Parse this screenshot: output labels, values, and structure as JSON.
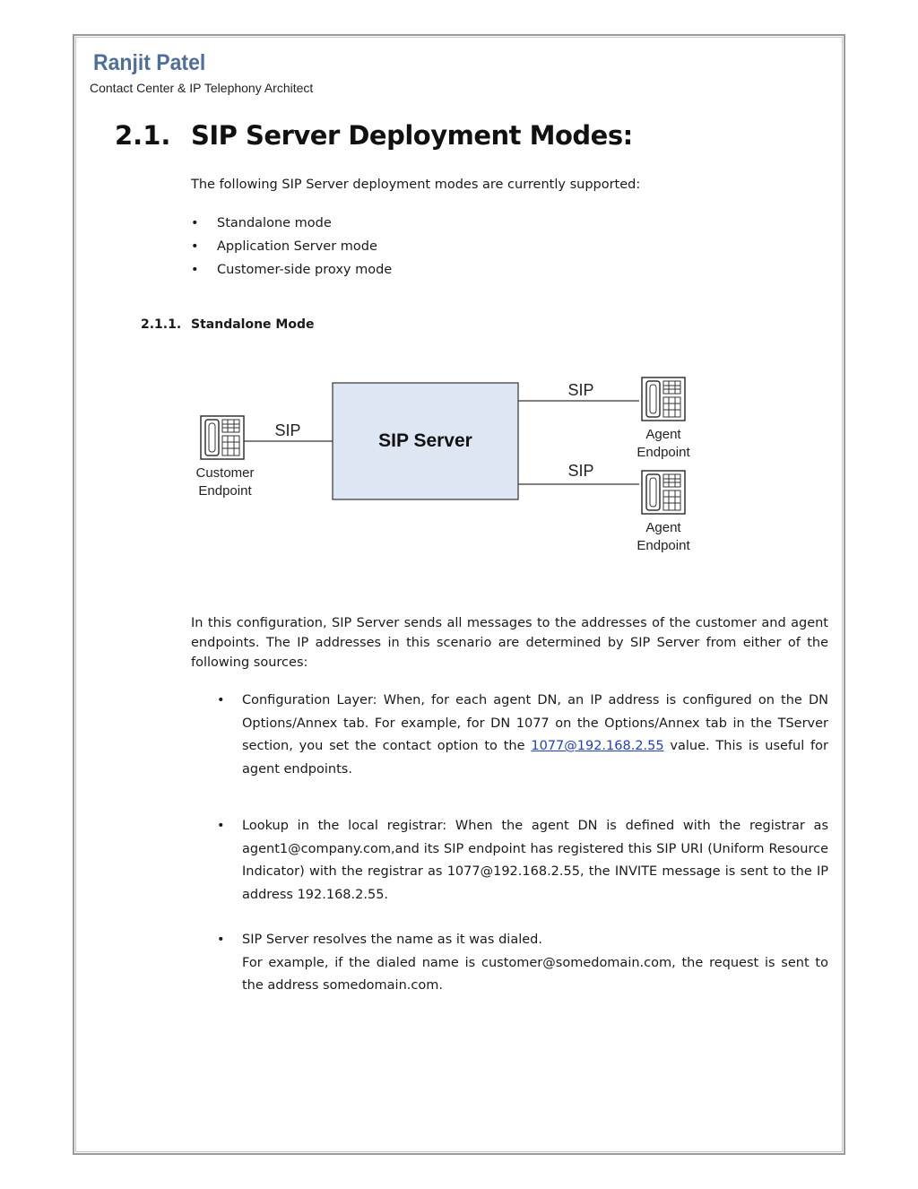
{
  "header": {
    "brand": "Ranjit Patel",
    "tagline": "Contact Center & IP Telephony Architect"
  },
  "section": {
    "number": "2.1.",
    "title": "SIP Server Deployment Modes:",
    "intro": "The following SIP Server deployment modes are currently supported:",
    "modes": [
      "Standalone mode",
      "Application Server mode",
      "Customer-side proxy mode"
    ],
    "bullet": "•"
  },
  "subsection": {
    "number": "2.1.1.",
    "title": "Standalone Mode"
  },
  "diagram": {
    "server_label": "SIP Server",
    "customer_link_label": "SIP",
    "agent_link_label_1": "SIP",
    "agent_link_label_2": "SIP",
    "customer_label_line1": "Customer",
    "customer_label_line2": "Endpoint",
    "agent1_label_line1": "Agent",
    "agent1_label_line2": "Endpoint",
    "agent2_label_line1": "Agent",
    "agent2_label_line2": "Endpoint",
    "server_fill": "#dde6f3"
  },
  "body": {
    "paragraph": "In this configuration, SIP Server sends all messages to the addresses of the customer and agent endpoints. The IP addresses in this scenario are determined by SIP Server from either of the following sources:",
    "sources": [
      {
        "text_before": "Configuration Layer: When, for each agent DN, an IP address is configured on the DN Options/Annex tab. For example, for DN 1077 on the Options/Annex tab in the TServer section, you set the contact option to the ",
        "link": "1077@192.168.2.55",
        "text_after": " value. This is useful for agent endpoints."
      },
      {
        "text": "Lookup in the local registrar: When the agent DN is defined with the registrar as agent1@company.com,and its SIP endpoint has registered this SIP URI (Uniform Resource Indicator) with the registrar as 1077@192.168.2.55, the INVITE message is sent to the IP address 192.168.2.55."
      },
      {
        "line1": "SIP Server resolves the name as it was dialed.",
        "line2": "For example, if the dialed name is customer@somedomain.com, the request is sent to the address somedomain.com."
      }
    ]
  }
}
